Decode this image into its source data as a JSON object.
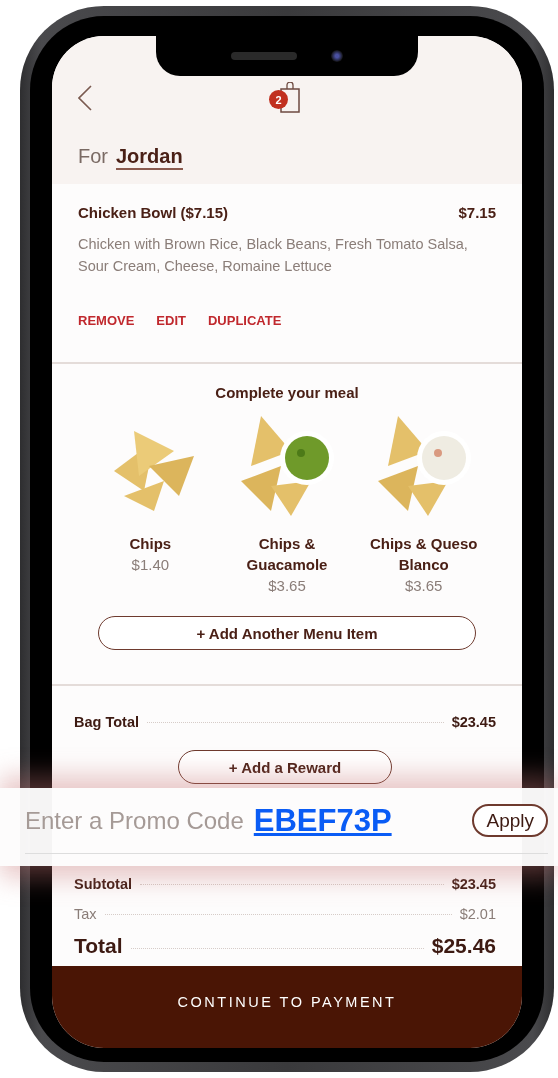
{
  "header": {
    "bag_count": "2"
  },
  "recipient": {
    "label": "For",
    "name": "Jordan"
  },
  "item": {
    "name": "Chicken Bowl ($7.15)",
    "price": "$7.15",
    "description": "Chicken with Brown Rice, Black Beans, Fresh Tomato Salsa, Sour Cream, Cheese, Romaine Lettuce",
    "actions": [
      "REMOVE",
      "EDIT",
      "DUPLICATE"
    ]
  },
  "upsell": {
    "title": "Complete your meal",
    "items": [
      {
        "name": "Chips",
        "price": "$1.40",
        "kind": "chips"
      },
      {
        "name": "Chips & Guacamole",
        "price": "$3.65",
        "kind": "guacamole"
      },
      {
        "name": "Chips & Queso Blanco",
        "price": "$3.65",
        "kind": "queso"
      }
    ],
    "add_button": "+ Add Another Menu Item"
  },
  "bag_total": {
    "label": "Bag Total",
    "value": "$23.45"
  },
  "reward_button": "+ Add a Reward",
  "promo": {
    "label": "Enter a Promo Code",
    "code": "EBEF73P",
    "apply": "Apply"
  },
  "summary": [
    {
      "label": "Subtotal",
      "value": "$23.45",
      "kind": "subtotal"
    },
    {
      "label": "Tax",
      "value": "$2.01",
      "kind": "tax"
    },
    {
      "label": "Total",
      "value": "$25.46",
      "kind": "total"
    }
  ],
  "continue_button": "CONTINUE TO PAYMENT"
}
